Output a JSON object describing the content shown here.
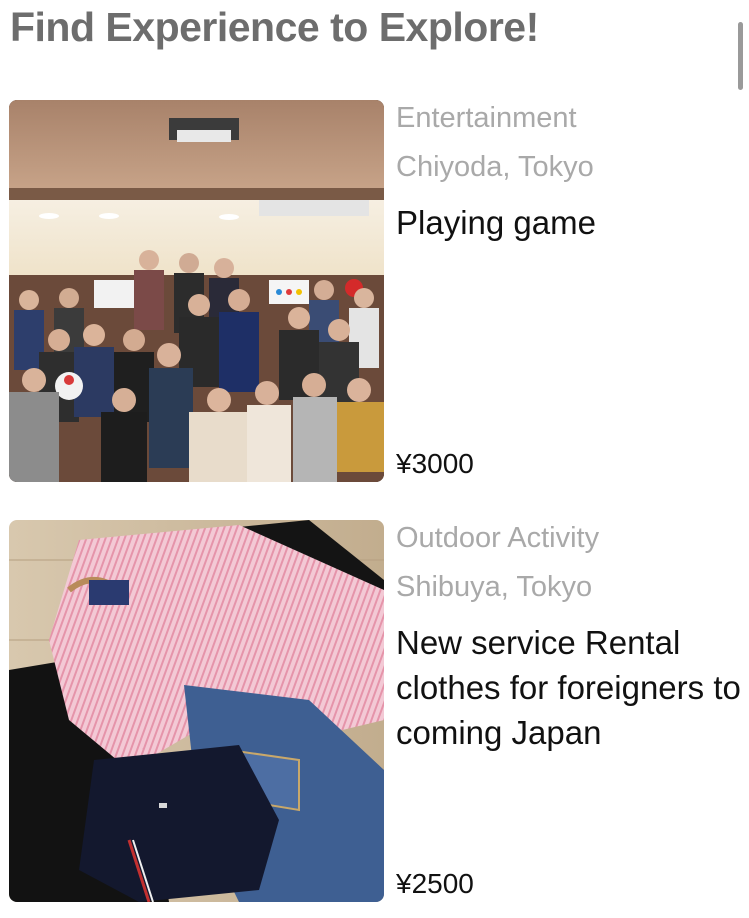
{
  "page": {
    "title": "Find Experience to Explore!"
  },
  "experiences": [
    {
      "category": "Entertainment",
      "location": "Chiyoda, Tokyo",
      "title": "Playing game",
      "price": "¥3000",
      "image": "group-photo"
    },
    {
      "category": "Outdoor Activity",
      "location": "Shibuya, Tokyo",
      "title": "New service Rental clothes for foreigners to coming Japan",
      "price": "¥2500",
      "image": "clothes-photo"
    }
  ]
}
